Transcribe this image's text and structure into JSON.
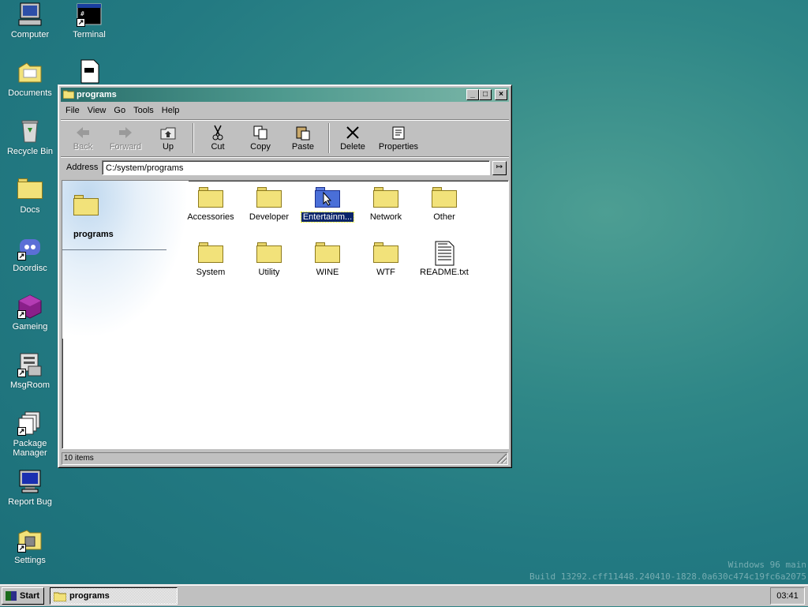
{
  "desktop": {
    "icons": [
      {
        "label": "Computer",
        "icon": "computer-icon"
      },
      {
        "label": "Terminal",
        "icon": "terminal-icon"
      },
      {
        "label": "Documents",
        "icon": "documents-folder-icon"
      },
      {
        "label": "Recycle Bin",
        "icon": "recycle-bin-icon"
      },
      {
        "label": "Docs",
        "icon": "folder-icon"
      },
      {
        "label": "Doordisc",
        "icon": "doordisc-icon"
      },
      {
        "label": "Gameing",
        "icon": "cube-icon"
      },
      {
        "label": "MsgRoom",
        "icon": "msgroom-icon"
      },
      {
        "label": "Package Manager",
        "icon": "package-icon"
      },
      {
        "label": "Report Bug",
        "icon": "monitor-icon"
      },
      {
        "label": "Settings",
        "icon": "settings-icon"
      }
    ],
    "file_icon": "file-icon"
  },
  "window": {
    "title": "programs",
    "menu": [
      "File",
      "View",
      "Go",
      "Tools",
      "Help"
    ],
    "toolbar": {
      "back": "Back",
      "forward": "Forward",
      "up": "Up",
      "cut": "Cut",
      "copy": "Copy",
      "paste": "Paste",
      "delete": "Delete",
      "properties": "Properties"
    },
    "address": {
      "label": "Address",
      "value": "C:/system/programs"
    },
    "sidepanel_title": "programs",
    "items": [
      {
        "label": "Accessories",
        "type": "folder"
      },
      {
        "label": "Developer",
        "type": "folder"
      },
      {
        "label": "Entertainm...",
        "type": "folder",
        "selected": true
      },
      {
        "label": "Network",
        "type": "folder"
      },
      {
        "label": "Other",
        "type": "folder"
      },
      {
        "label": "System",
        "type": "folder"
      },
      {
        "label": "Utility",
        "type": "folder"
      },
      {
        "label": "WINE",
        "type": "folder"
      },
      {
        "label": "WTF",
        "type": "folder"
      },
      {
        "label": "README.txt",
        "type": "text-file"
      }
    ],
    "status": "10 items"
  },
  "taskbar": {
    "start_label": "Start",
    "task_label": "programs",
    "clock": "03:41"
  },
  "watermark": {
    "line1": "Windows 96 main",
    "line2": "Build 13292.cff11448.240410-1828.0a630c474c19fc6a2075"
  }
}
